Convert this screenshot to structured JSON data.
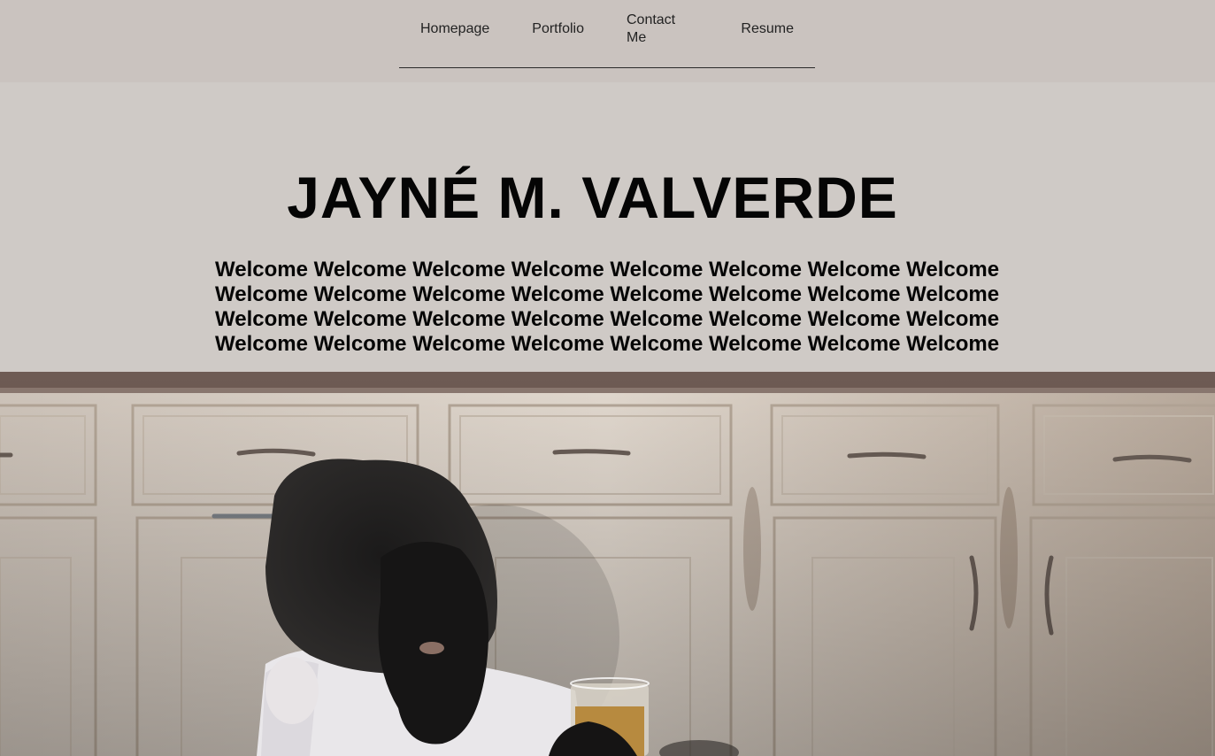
{
  "nav": {
    "items": [
      {
        "label": "Homepage"
      },
      {
        "label": "Portfolio"
      },
      {
        "label": "Contact Me"
      },
      {
        "label": "Resume"
      }
    ]
  },
  "hero": {
    "title": "JAYNÉ M. VALVERDE",
    "welcome_text": "Welcome Welcome Welcome Welcome Welcome Welcome Welcome Welcome Welcome Welcome Welcome Welcome Welcome Welcome Welcome Welcome Welcome Welcome Welcome Welcome Welcome Welcome Welcome Welcome Welcome Welcome Welcome Welcome Welcome Welcome Welcome Welcome"
  },
  "colors": {
    "topbar": "#cac3bf",
    "page": "#cfcac6",
    "text": "#050505"
  }
}
